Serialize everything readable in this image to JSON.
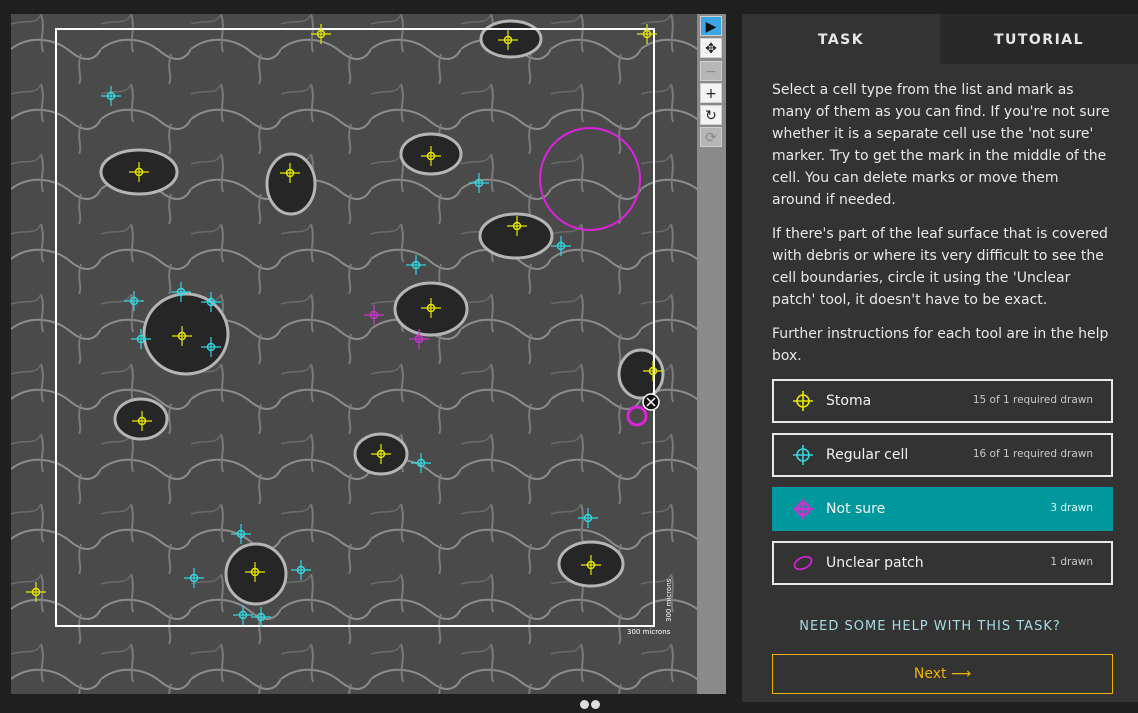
{
  "tabs": [
    {
      "label": "TASK"
    },
    {
      "label": "TUTORIAL"
    }
  ],
  "instructions": [
    "Select a cell type from the list and mark as many of them as you can find. If you're not sure whether it is a separate cell use the 'not sure' marker. Try to get the mark in the middle of the cell. You can delete marks or move them around if needed.",
    "If there's part of the leaf surface that is covered with debris or where its very difficult to see the cell boundaries, circle it using the 'Unclear patch' tool, it doesn't have to be exact.",
    "Further instructions for each tool are in the help box."
  ],
  "tools": [
    {
      "label": "Stoma",
      "count": "15 of 1 required drawn",
      "color": "#e6e600",
      "icon": "crosshair-icon"
    },
    {
      "label": "Regular cell",
      "count": "16 of 1 required drawn",
      "color": "#33d6e0",
      "icon": "crosshair-icon"
    },
    {
      "label": "Not sure",
      "count": "3 drawn",
      "color": "#cc33cc",
      "icon": "crosshair-icon"
    },
    {
      "label": "Unclear patch",
      "count": "1 drawn",
      "color": "#dd22dd",
      "icon": "ellipse-icon"
    }
  ],
  "help_label": "NEED SOME HELP WITH THIS TASK?",
  "next_label": "Next ⟶",
  "scale_label": "300 microns",
  "viewer_tools": [
    {
      "name": "select-tool",
      "icon": "▶",
      "active": true
    },
    {
      "name": "pan-tool",
      "icon": "✥"
    },
    {
      "name": "zoom-out-tool",
      "icon": "−",
      "disabled": true
    },
    {
      "name": "zoom-in-tool",
      "icon": "+"
    },
    {
      "name": "rotate-tool",
      "icon": "↻"
    },
    {
      "name": "reset-tool",
      "icon": "⟳",
      "disabled": true
    }
  ],
  "colors": {
    "stoma": "#e6e600",
    "regular": "#33d6e0",
    "notsure": "#cc33cc",
    "patch": "#dd22dd",
    "accent": "#00979d",
    "next": "#f0b200"
  }
}
